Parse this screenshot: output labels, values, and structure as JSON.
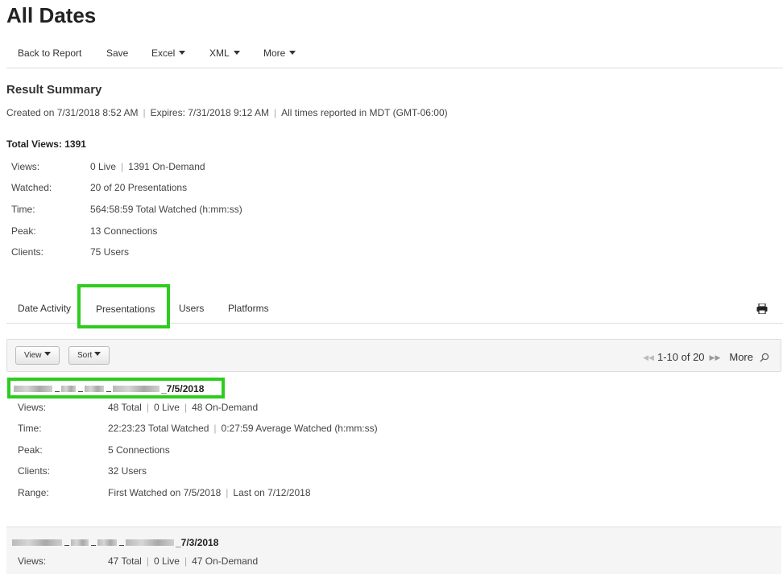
{
  "page": {
    "title": "All Dates"
  },
  "toolbar": {
    "back": "Back to Report",
    "save": "Save",
    "excel": "Excel",
    "xml": "XML",
    "more": "More"
  },
  "summary": {
    "title": "Result Summary",
    "created": "Created on 7/31/2018 8:52 AM",
    "expires": "Expires: 7/31/2018 9:12 AM",
    "timezone": "All times reported in MDT (GMT-06:00)",
    "total_views": "Total Views: 1391",
    "views_label": "Views:",
    "views_live": "0 Live",
    "views_ondemand": "1391 On-Demand",
    "watched_label": "Watched:",
    "watched_value": "20 of 20 Presentations",
    "time_label": "Time:",
    "time_value": "564:58:59 Total Watched (h:mm:ss)",
    "peak_label": "Peak:",
    "peak_value": "13 Connections",
    "clients_label": "Clients:",
    "clients_value": "75 Users"
  },
  "tabs": {
    "date_activity": "Date Activity",
    "presentations": "Presentations",
    "users": "Users",
    "platforms": "Platforms",
    "active": "presentations"
  },
  "viewbar": {
    "view": "View",
    "sort": "Sort",
    "range": "1-10 of 20",
    "more": "More"
  },
  "presentations": [
    {
      "title_suffix": "_7/5/2018",
      "views_label": "Views:",
      "views_total": "48 Total",
      "views_live": "0 Live",
      "views_ondemand": "48 On-Demand",
      "time_label": "Time:",
      "time_total": "22:23:23 Total Watched",
      "time_avg": "0:27:59 Average Watched (h:mm:ss)",
      "peak_label": "Peak:",
      "peak_value": "5 Connections",
      "clients_label": "Clients:",
      "clients_value": "32 Users",
      "range_label": "Range:",
      "range_first": "First Watched on 7/5/2018",
      "range_last": "Last on 7/12/2018"
    },
    {
      "title_suffix": "_7/3/2018",
      "views_label": "Views:",
      "views_total": "47 Total",
      "views_live": "0 Live",
      "views_ondemand": "47 On-Demand"
    }
  ],
  "colors": {
    "highlight": "#2ecc1f",
    "panel_bg": "#f5f5f5"
  },
  "icons": {
    "print": "printer-icon",
    "search": "search-icon"
  }
}
